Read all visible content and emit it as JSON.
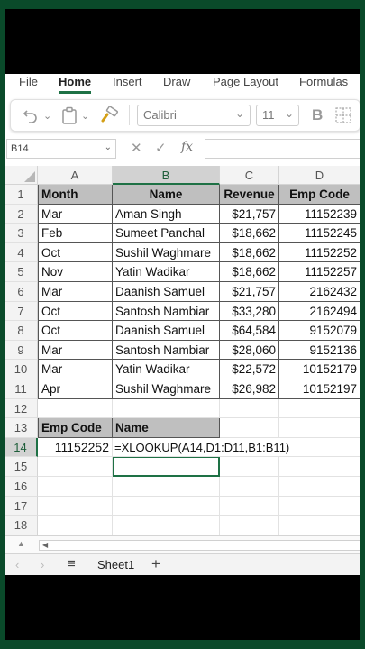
{
  "ribbon": {
    "tabs": [
      "File",
      "Home",
      "Insert",
      "Draw",
      "Page Layout",
      "Formulas"
    ],
    "active": "Home"
  },
  "toolbar": {
    "font_name": "Calibri",
    "font_size": "11",
    "bold_label": "B"
  },
  "formula_bar": {
    "name_box": "B14",
    "cancel_glyph": "✕",
    "enter_glyph": "✓",
    "fx_glyph": "fx",
    "content": ""
  },
  "grid": {
    "columns": [
      "A",
      "B",
      "C",
      "D"
    ],
    "rows": [
      "1",
      "2",
      "3",
      "4",
      "5",
      "6",
      "7",
      "8",
      "9",
      "10",
      "11",
      "12",
      "13",
      "14",
      "15",
      "16",
      "17",
      "18"
    ],
    "table_headers": [
      "Month",
      "Name",
      "Revenue",
      "Emp Code"
    ],
    "table_rows": [
      [
        "Mar",
        "Aman Singh",
        "$21,757",
        "11152239"
      ],
      [
        "Feb",
        "Sumeet Panchal",
        "$18,662",
        "11152245"
      ],
      [
        "Oct",
        "Sushil Waghmare",
        "$18,662",
        "11152252"
      ],
      [
        "Nov",
        "Yatin Wadikar",
        "$18,662",
        "11152257"
      ],
      [
        "Mar",
        "Daanish Samuel",
        "$21,757",
        "2162432"
      ],
      [
        "Oct",
        "Santosh Nambiar",
        "$33,280",
        "2162494"
      ],
      [
        "Oct",
        "Daanish Samuel",
        "$64,584",
        "9152079"
      ],
      [
        "Mar",
        "Santosh Nambiar",
        "$28,060",
        "9152136"
      ],
      [
        "Mar",
        "Yatin Wadikar",
        "$22,572",
        "10152179"
      ],
      [
        "Apr",
        "Sushil Waghmare",
        "$26,982",
        "10152197"
      ]
    ],
    "lookup_headers": [
      "Emp Code",
      "Name"
    ],
    "lookup_value": "11152252",
    "lookup_formula": "=XLOOKUP(A14,D1:D11,B1:B11)"
  },
  "sheets": {
    "active": "Sheet1",
    "add_glyph": "+",
    "menu_glyph": "≡"
  },
  "colors": {
    "accent": "#1e7145",
    "header_fill": "#bfbfbf",
    "background": "#0a4a2a"
  }
}
